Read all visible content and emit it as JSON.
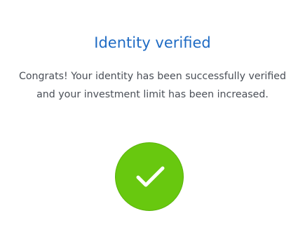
{
  "dialog": {
    "title": "Identity verified",
    "message_line1": "Congrats! Your identity has been successfully verified",
    "message_line2": "and your investment limit has been increased."
  },
  "icons": {
    "success": "checkmark-icon"
  },
  "colors": {
    "title": "#1f6bc4",
    "text": "#4a4f57",
    "success": "#68c80f"
  }
}
